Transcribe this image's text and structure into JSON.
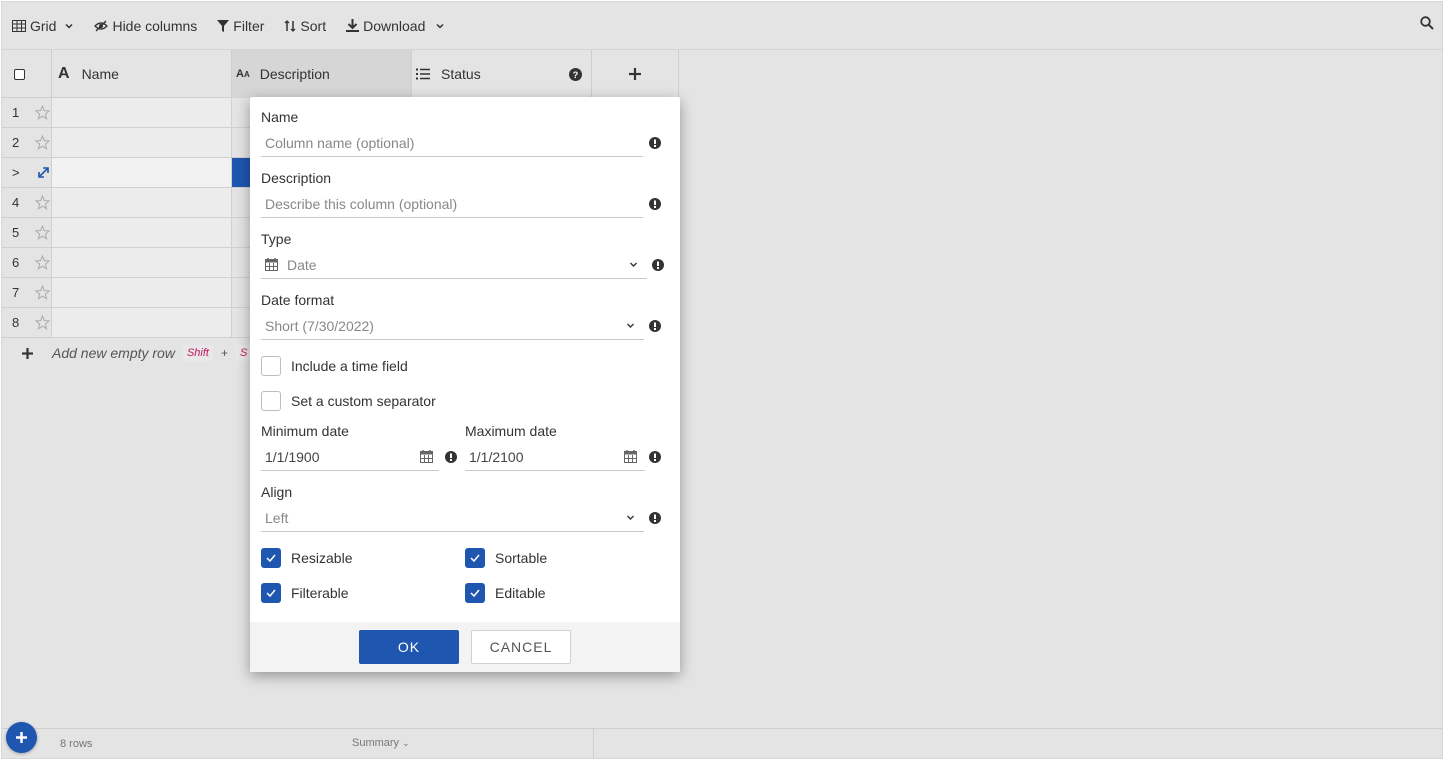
{
  "toolbar": {
    "grid_label": "Grid",
    "hide_columns_label": "Hide columns",
    "filter_label": "Filter",
    "sort_label": "Sort",
    "download_label": "Download"
  },
  "columns": {
    "name": "Name",
    "description": "Description",
    "status": "Status"
  },
  "rows": [
    {
      "index": "1"
    },
    {
      "index": "2"
    },
    {
      "index": ">"
    },
    {
      "index": "4"
    },
    {
      "index": "5"
    },
    {
      "index": "6"
    },
    {
      "index": "7"
    },
    {
      "index": "8"
    }
  ],
  "add_row": {
    "text": "Add new empty row",
    "shortcut_key": "Shift",
    "shortcut_plus": "+",
    "shortcut_partial": "S"
  },
  "footer": {
    "row_count": "8 rows",
    "summary_label": "Summary"
  },
  "dialog": {
    "name_label": "Name",
    "name_placeholder": "Column name (optional)",
    "description_label": "Description",
    "description_placeholder": "Describe this column (optional)",
    "type_label": "Type",
    "type_value": "Date",
    "date_format_label": "Date format",
    "date_format_value": "Short (7/30/2022)",
    "include_time_label": "Include a time field",
    "custom_separator_label": "Set a custom separator",
    "min_date_label": "Minimum date",
    "min_date_value": "1/1/1900",
    "max_date_label": "Maximum date",
    "max_date_value": "1/1/2100",
    "align_label": "Align",
    "align_value": "Left",
    "resizable_label": "Resizable",
    "sortable_label": "Sortable",
    "filterable_label": "Filterable",
    "editable_label": "Editable",
    "ok_label": "OK",
    "cancel_label": "CANCEL"
  },
  "colors": {
    "accent": "#1e56b0",
    "shortcut": "#c2185b",
    "background": "#e4e4e4"
  }
}
